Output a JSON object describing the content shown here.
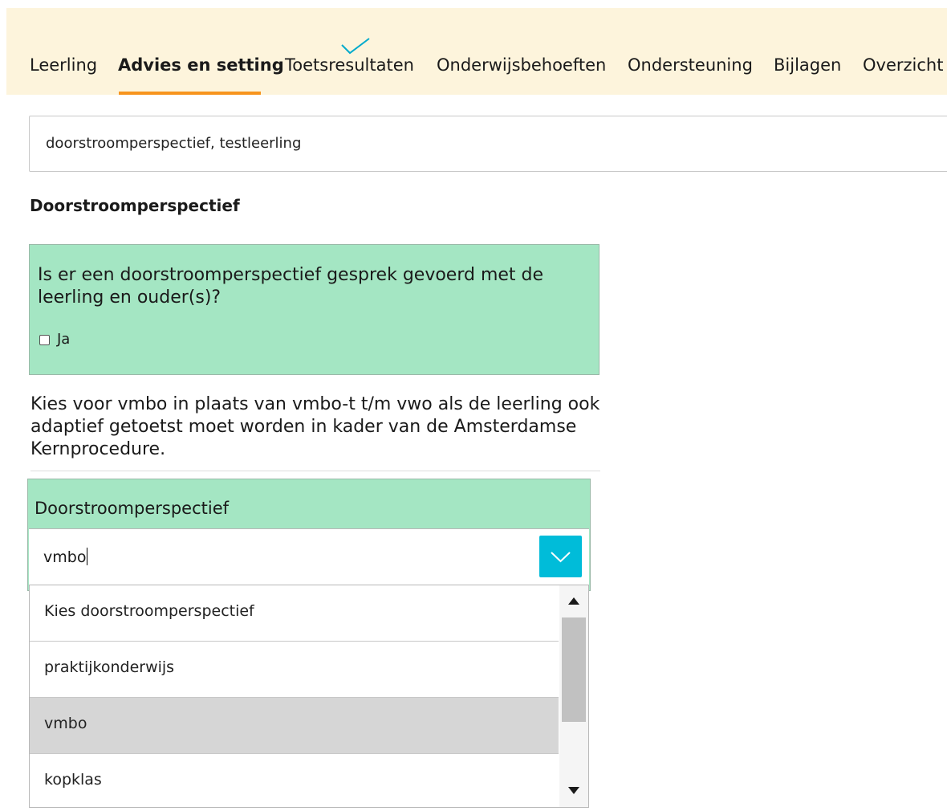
{
  "nav": {
    "tabs": [
      {
        "label": "Leerling"
      },
      {
        "label": "Advies en setting",
        "active": true
      },
      {
        "label": "Toetsresultaten",
        "completed": true
      },
      {
        "label": "Onderwijsbehoeften"
      },
      {
        "label": "Ondersteuning"
      },
      {
        "label": "Bijlagen"
      },
      {
        "label": "Overzicht"
      }
    ]
  },
  "search": {
    "value": "doorstroomperspectief, testleerling"
  },
  "section": {
    "title": "Doorstroomperspectief"
  },
  "question": {
    "text": "Is er een doorstroomperspectief gesprek gevoerd met de leerling en ouder(s)?",
    "checkbox_label": "Ja",
    "checked": false
  },
  "info": {
    "text": "Kies voor vmbo in plaats van vmbo-t t/m vwo als de leerling ook adaptief getoetst moet worden in kader van de Amsterdamse Kernprocedure."
  },
  "select": {
    "label": "Doorstroomperspectief",
    "value": "vmbo",
    "options": [
      {
        "label": "Kies doorstroomperspectief"
      },
      {
        "label": "praktijkonderwijs"
      },
      {
        "label": "vmbo",
        "highlighted": true
      },
      {
        "label": "kopklas"
      }
    ]
  },
  "colors": {
    "tab_bar_bg": "#fdf4dc",
    "active_tab_underline": "#f7941d",
    "check": "#00aacc",
    "panel_green": "#a4e6c3",
    "dropdown_button": "#00bcd9",
    "option_highlight": "#d6d6d6"
  },
  "icons": {
    "completed": "check-icon",
    "toggle": "chevron-down-icon",
    "scroll_up": "arrow-up-icon",
    "scroll_down": "arrow-down-icon"
  }
}
